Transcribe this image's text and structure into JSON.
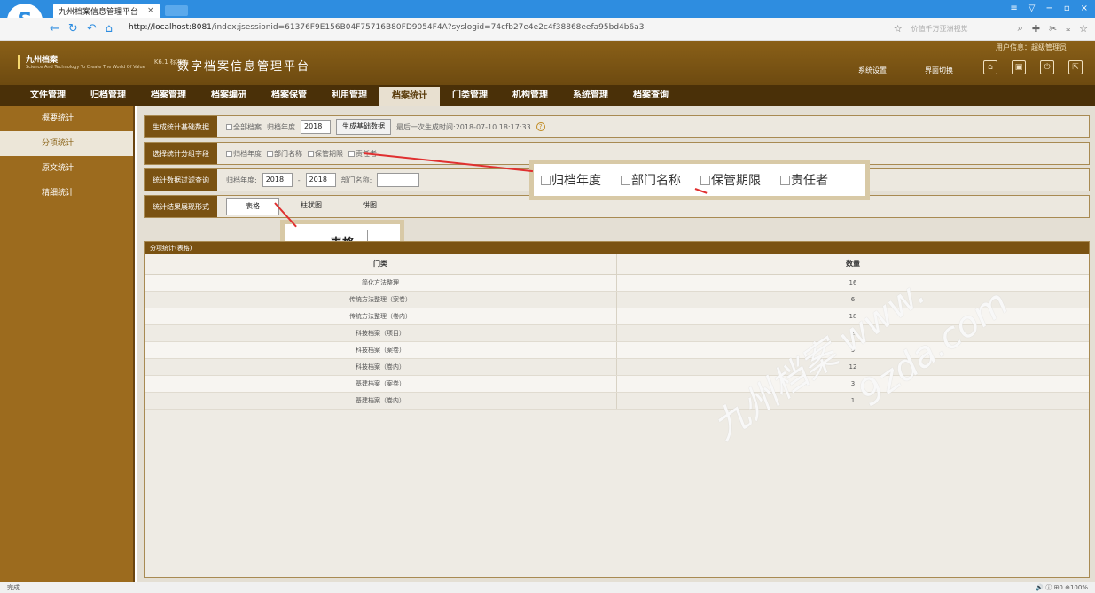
{
  "browser": {
    "logo": "S",
    "tab_title": "九州档案信息管理平台",
    "tab_close": "×",
    "window_controls": [
      "≡",
      "▽",
      "−",
      "▫",
      "×"
    ],
    "url_host": "http://localhost:8081",
    "url_path": "/index;jsessionid=61376F9E156B04F75716B80FD9054F4A?syslogid=74cfb27e4e2c4f38868eefa95bd4b6a3",
    "search_placeholder": "价值千万亚洲视觉"
  },
  "header": {
    "user_info": "用户信息：超级管理员",
    "logo_name": "九州档案",
    "logo_sub": "Science And Technology To Create The World Of Value",
    "logo_version": "K6.1 标准版",
    "platform_title": "数字档案信息管理平台",
    "system_settings": "系统设置",
    "interface_switch": "界面切换"
  },
  "nav": {
    "items": [
      "文件管理",
      "归档管理",
      "档案管理",
      "档案编研",
      "档案保管",
      "利用管理",
      "档案统计",
      "门类管理",
      "机构管理",
      "系统管理",
      "档案查询"
    ]
  },
  "sidebar": {
    "items": [
      "概要统计",
      "分项统计",
      "原文统计",
      "精细统计"
    ]
  },
  "filters": {
    "gen_label": "生成统计基础数据",
    "all_archives": "全部档案",
    "archive_year": "归档年度",
    "year_value": "2018",
    "gen_button": "生成基础数据",
    "last_gen": "最后一次生成时间:2018-07-10 18:17:33",
    "help": "?",
    "group_label": "选择统计分组字段",
    "group_fields": [
      "归档年度",
      "部门名称",
      "保管期限",
      "责任者"
    ],
    "query_label": "统计数据过滤查询",
    "year_label": "归档年度:",
    "year_from": "2018",
    "year_to": "2018",
    "dept_label": "部门名称:",
    "display_label": "统计结果展现形式",
    "views": [
      "表格",
      "柱状图",
      "饼图"
    ]
  },
  "callouts": {
    "fields": [
      "归档年度",
      "部门名称",
      "保管期限",
      "责任者"
    ],
    "table": "表格"
  },
  "table": {
    "title": "分项统计(表格)",
    "headers": [
      "门类",
      "数量"
    ],
    "rows": [
      [
        "简化方法整理",
        "16"
      ],
      [
        "传统方法整理（案卷）",
        "6"
      ],
      [
        "传统方法整理（卷内）",
        "18"
      ],
      [
        "科技档案（项目）",
        "2"
      ],
      [
        "科技档案（案卷）",
        "9"
      ],
      [
        "科技档案（卷内）",
        "12"
      ],
      [
        "基建档案（案卷）",
        "3"
      ],
      [
        "基建档案（卷内）",
        "1"
      ]
    ]
  },
  "watermark": {
    "text1": "九州档案 www.",
    "text2": "9zda.com"
  },
  "status": {
    "left": "完成",
    "right": "🔊  ⓘ  ⊞0  ⊕100%"
  }
}
